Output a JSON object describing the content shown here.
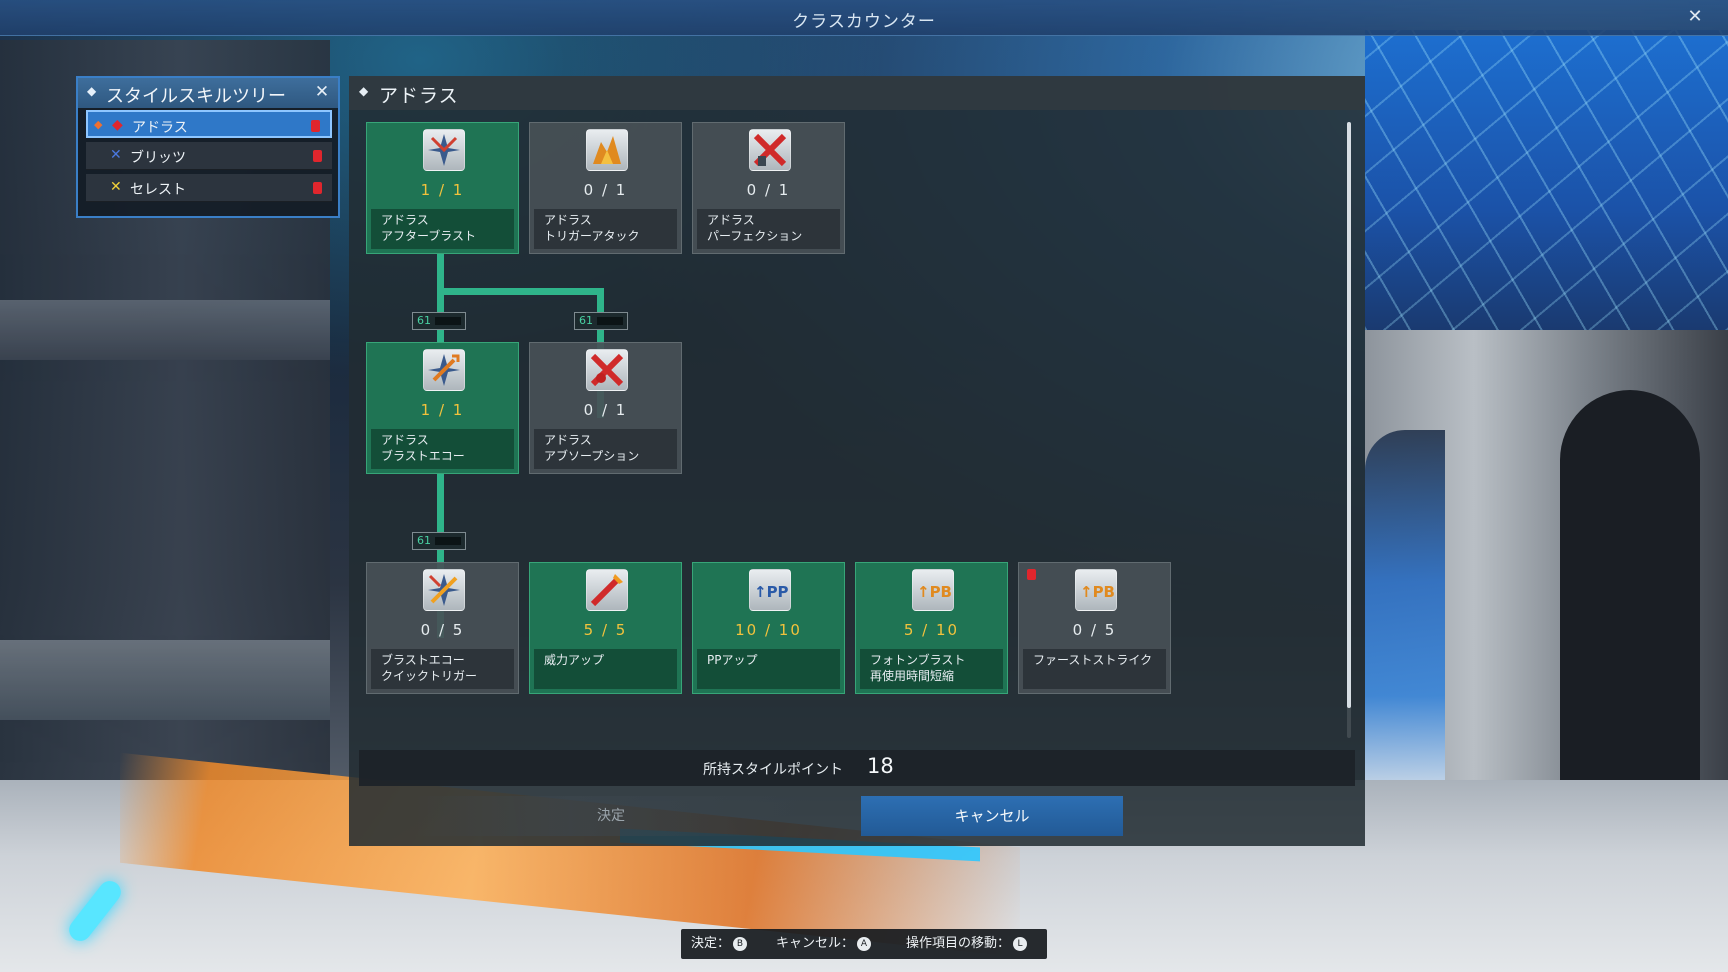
{
  "window": {
    "title": "クラスカウンター",
    "close_glyph": "✕"
  },
  "style_tree": {
    "title": "スタイルスキルツリー",
    "close_glyph": "✕",
    "items": [
      {
        "label": "アドラス",
        "icon": "adras-icon",
        "icon_glyph": "◆",
        "icon_color": "#e0262d",
        "active": true
      },
      {
        "label": "ブリッツ",
        "icon": "blitz-icon",
        "icon_glyph": "✕",
        "icon_color": "#4a78e0",
        "active": false
      },
      {
        "label": "セレスト",
        "icon": "celest-icon",
        "icon_glyph": "✕",
        "icon_color": "#f2d13a",
        "active": false
      }
    ]
  },
  "main": {
    "title": "アドラス",
    "nodes": [
      {
        "id": "after-blast",
        "name": "アドラス\nアフターブラスト",
        "level": "1 / 1",
        "learned": true,
        "icon": "after-blast-icon"
      },
      {
        "id": "trigger-attack",
        "name": "アドラス\nトリガーアタック",
        "level": "0 / 1",
        "learned": false,
        "icon": "trigger-attack-icon"
      },
      {
        "id": "perfection",
        "name": "アドラス\nパーフェクション",
        "level": "0 / 1",
        "learned": false,
        "icon": "perfection-icon"
      },
      {
        "id": "blast-echo",
        "name": "アドラス\nブラストエコー",
        "level": "1 / 1",
        "learned": true,
        "icon": "blast-echo-icon"
      },
      {
        "id": "absorption",
        "name": "アドラス\nアブソープション",
        "level": "0 / 1",
        "learned": false,
        "icon": "absorption-icon"
      },
      {
        "id": "echo-quick",
        "name": "ブラストエコー\nクイックトリガー",
        "level": "0 / 5",
        "learned": false,
        "icon": "quick-trigger-icon"
      },
      {
        "id": "power-up",
        "name": "威力アップ",
        "level": "5 / 5",
        "learned": true,
        "icon": "power-up-icon"
      },
      {
        "id": "pp-up",
        "name": "PPアップ",
        "level": "10 / 10",
        "learned": true,
        "icon": "pp-up-icon"
      },
      {
        "id": "photon-blast",
        "name": "フォトンブラスト\n再使用時間短縮",
        "level": "5 / 10",
        "learned": true,
        "icon": "photon-blast-icon"
      },
      {
        "id": "first-strike",
        "name": "ファーストストライク",
        "level": "0 / 5",
        "learned": false,
        "icon": "first-strike-icon"
      }
    ],
    "requirement_badges": [
      {
        "label": "61",
        "icon": "level-requirement-icon"
      },
      {
        "label": "61",
        "icon": "level-requirement-icon"
      },
      {
        "label": "61",
        "icon": "level-requirement-icon"
      }
    ],
    "points": {
      "label": "所持スタイルポイント",
      "value": "18"
    },
    "ok_label": "決定",
    "cancel_label": "キャンセル"
  },
  "hints": [
    {
      "label": "決定：",
      "key": "B",
      "icon": "button-b-icon"
    },
    {
      "label": "キャンセル：",
      "key": "A",
      "icon": "button-a-icon"
    },
    {
      "label": "操作項目の移動：",
      "key": "L",
      "icon": "stick-icon"
    }
  ],
  "colors": {
    "learned_node": "#1f7454",
    "unlearned_node": "#485056",
    "level_highlight": "#f2c23c",
    "accent_blue": "#2d6fb3",
    "new_badge": "#e0262d"
  }
}
